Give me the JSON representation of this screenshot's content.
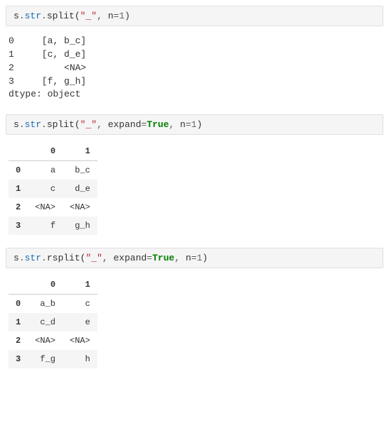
{
  "block1": {
    "code": {
      "obj": "s",
      "attr": "str",
      "method": "split",
      "arg_str": "\"_\"",
      "arg_n_key": "n",
      "arg_n_val": "1"
    },
    "output_lines": [
      "0     [a, b_c]",
      "1     [c, d_e]",
      "2         <NA>",
      "3     [f, g_h]",
      "dtype: object"
    ]
  },
  "block2": {
    "code": {
      "obj": "s",
      "attr": "str",
      "method": "split",
      "arg_str": "\"_\"",
      "arg_expand_key": "expand",
      "arg_expand_val": "True",
      "arg_n_key": "n",
      "arg_n_val": "1"
    },
    "table": {
      "columns": [
        "0",
        "1"
      ],
      "index": [
        "0",
        "1",
        "2",
        "3"
      ],
      "rows": [
        [
          "a",
          "b_c"
        ],
        [
          "c",
          "d_e"
        ],
        [
          "<NA>",
          "<NA>"
        ],
        [
          "f",
          "g_h"
        ]
      ]
    }
  },
  "block3": {
    "code": {
      "obj": "s",
      "attr": "str",
      "method": "rsplit",
      "arg_str": "\"_\"",
      "arg_expand_key": "expand",
      "arg_expand_val": "True",
      "arg_n_key": "n",
      "arg_n_val": "1"
    },
    "table": {
      "columns": [
        "0",
        "1"
      ],
      "index": [
        "0",
        "1",
        "2",
        "3"
      ],
      "rows": [
        [
          "a_b",
          "c"
        ],
        [
          "c_d",
          "e"
        ],
        [
          "<NA>",
          "<NA>"
        ],
        [
          "f_g",
          "h"
        ]
      ]
    }
  }
}
